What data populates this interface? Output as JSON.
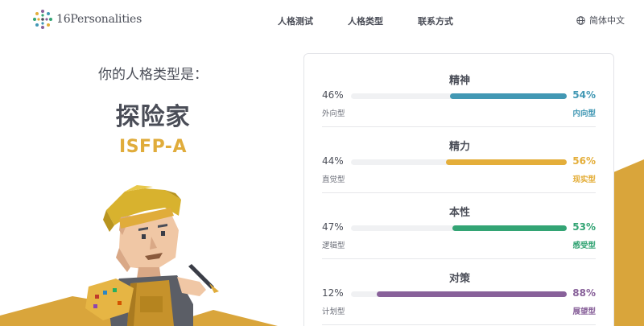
{
  "header": {
    "logo_text": "16Personalities",
    "nav": [
      "人格测试",
      "人格类型",
      "联系方式"
    ],
    "language": "简体中文"
  },
  "result": {
    "label": "你的人格类型是：",
    "type_name": "探险家",
    "type_code": "ISFP-A"
  },
  "traits": [
    {
      "title": "精神",
      "left_pct": "46%",
      "right_pct": "54%",
      "left_label": "外向型",
      "right_label": "内向型",
      "right_value": 54,
      "color": "#4298b4"
    },
    {
      "title": "精力",
      "left_pct": "44%",
      "right_pct": "56%",
      "left_label": "直觉型",
      "right_label": "现实型",
      "right_value": 56,
      "color": "#e4ae3a"
    },
    {
      "title": "本性",
      "left_pct": "47%",
      "right_pct": "53%",
      "left_label": "逻辑型",
      "right_label": "感受型",
      "right_value": 53,
      "color": "#33a474"
    },
    {
      "title": "对策",
      "left_pct": "12%",
      "right_pct": "88%",
      "left_label": "计划型",
      "right_label": "展望型",
      "right_value": 88,
      "color": "#88619a"
    }
  ],
  "icons": {
    "logo": "16personalities-logo-icon",
    "language": "globe-icon"
  },
  "colors": {
    "accent_gold": "#e0ac3b",
    "background_shape": "#d9a53b"
  }
}
